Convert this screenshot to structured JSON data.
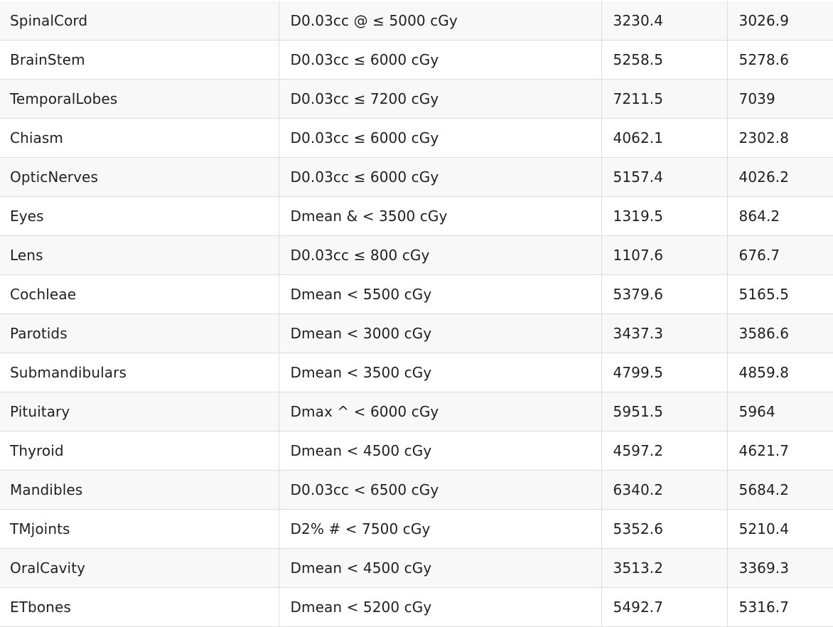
{
  "table": {
    "rows": [
      {
        "structure": "SpinalCord",
        "constraint": "D0.03cc @ ≤ 5000 cGy",
        "value1": "3230.4",
        "value2": "3026.9"
      },
      {
        "structure": "BrainStem",
        "constraint": "D0.03cc ≤ 6000 cGy",
        "value1": "5258.5",
        "value2": "5278.6"
      },
      {
        "structure": "TemporalLobes",
        "constraint": "D0.03cc ≤ 7200 cGy",
        "value1": "7211.5",
        "value2": "7039"
      },
      {
        "structure": "Chiasm",
        "constraint": "D0.03cc ≤ 6000 cGy",
        "value1": "4062.1",
        "value2": "2302.8"
      },
      {
        "structure": "OpticNerves",
        "constraint": "D0.03cc ≤ 6000 cGy",
        "value1": "5157.4",
        "value2": "4026.2"
      },
      {
        "structure": "Eyes",
        "constraint": "Dmean & < 3500 cGy",
        "value1": "1319.5",
        "value2": "864.2"
      },
      {
        "structure": "Lens",
        "constraint": "D0.03cc ≤ 800 cGy",
        "value1": "1107.6",
        "value2": "676.7"
      },
      {
        "structure": "Cochleae",
        "constraint": "Dmean < 5500 cGy",
        "value1": "5379.6",
        "value2": "5165.5"
      },
      {
        "structure": "Parotids",
        "constraint": "Dmean < 3000 cGy",
        "value1": "3437.3",
        "value2": "3586.6"
      },
      {
        "structure": "Submandibulars",
        "constraint": "Dmean < 3500 cGy",
        "value1": "4799.5",
        "value2": "4859.8"
      },
      {
        "structure": "Pituitary",
        "constraint": "Dmax ^ < 6000 cGy",
        "value1": "5951.5",
        "value2": "5964"
      },
      {
        "structure": "Thyroid",
        "constraint": "Dmean < 4500 cGy",
        "value1": "4597.2",
        "value2": "4621.7"
      },
      {
        "structure": "Mandibles",
        "constraint": "D0.03cc < 6500 cGy",
        "value1": "6340.2",
        "value2": "5684.2"
      },
      {
        "structure": "TMjoints",
        "constraint": "D2% # < 7500 cGy",
        "value1": "5352.6",
        "value2": "5210.4"
      },
      {
        "structure": "OralCavity",
        "constraint": "Dmean < 4500 cGy",
        "value1": "3513.2",
        "value2": "3369.3"
      },
      {
        "structure": "ETbones",
        "constraint": "Dmean < 5200 cGy",
        "value1": "5492.7",
        "value2": "5316.7"
      }
    ]
  }
}
